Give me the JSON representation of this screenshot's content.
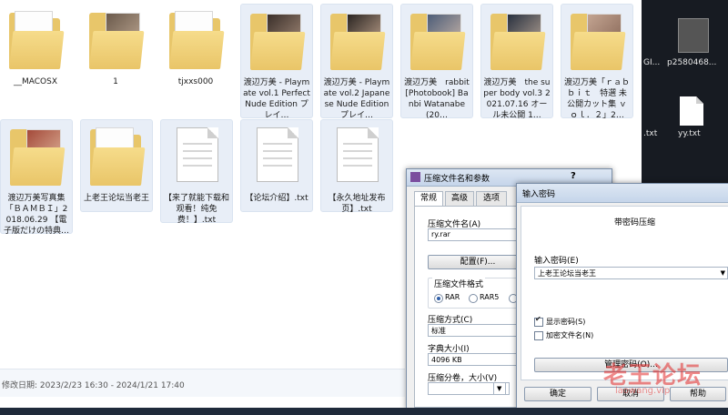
{
  "explorer": {
    "items": [
      {
        "label": "__MACOSX",
        "kind": "folder"
      },
      {
        "label": "1",
        "kind": "folder-photo"
      },
      {
        "label": "tjxxs000",
        "kind": "folder"
      },
      {
        "label": "渡辺万美 - Playmate vol.1 Perfect Nude Edition プレイ…",
        "kind": "folder-photo"
      },
      {
        "label": "渡辺万美 - Playmate vol.2 Japanese Nude Edition プレイ…",
        "kind": "folder-photo"
      },
      {
        "label": "渡辺万美　rabbit [Photobook] Banbi Watanabe (20…",
        "kind": "folder-photo"
      },
      {
        "label": "渡辺万美　the super body vol.3 2021.07.16 オール未公開 1…",
        "kind": "folder-photo"
      },
      {
        "label": "渡辺万美「ｒａｂｂｉｔ　特選 未公開カット集 ｖｏｌ．２」2…",
        "kind": "folder-photo"
      },
      {
        "label": "渡辺万美写真集「ＢＡＭＢＩ」2018.06.29 【電子版だけの特典…",
        "kind": "folder-photo"
      },
      {
        "label": "上老王论坛当老王",
        "kind": "folder"
      },
      {
        "label": "【来了就能下载和观看！纯免费！】.txt",
        "kind": "txt"
      },
      {
        "label": "【论坛介绍】.txt",
        "kind": "txt"
      },
      {
        "label": "【永久地址发布页】.txt",
        "kind": "txt"
      }
    ],
    "status": "修改日期: 2023/2/23 16:30 - 2024/1/21 17:40"
  },
  "desktop": {
    "labels": [
      "GI...",
      "p2580468...",
      ".txt",
      "yy.txt"
    ]
  },
  "compress_dialog": {
    "title": "压缩文件名和参数",
    "help_glyph": "?",
    "tabs": [
      "常规",
      "高级",
      "选项"
    ],
    "archive_name_label": "压缩文件名(A)",
    "archive_name_value": "ry.rar",
    "profiles_button": "配置(F)...",
    "format_label": "压缩文件格式",
    "format_options": [
      "RAR",
      "RAR5"
    ],
    "method_label": "压缩方式(C)",
    "method_value": "标准",
    "dict_label": "字典大小(I)",
    "dict_value": "4096 KB",
    "split_label": "压缩分卷，大小(V)"
  },
  "password_dialog": {
    "title": "输入密码",
    "heading": "带密码压缩",
    "password_label": "输入密码(E)",
    "password_value": "上老王论坛当老王",
    "show_password": "显示密码(S)",
    "encrypt_names": "加密文件名(N)",
    "manage_button": "管理密码(O)...",
    "ok": "确定",
    "cancel": "取消",
    "help": "帮助"
  },
  "watermark": {
    "main": "老王论坛",
    "url": "laowang.vip"
  },
  "colors": {
    "folder": "#e8c66a",
    "title_bar": "#c5d5ea",
    "selection": "#e8eef7",
    "desktop": "#171b22"
  }
}
